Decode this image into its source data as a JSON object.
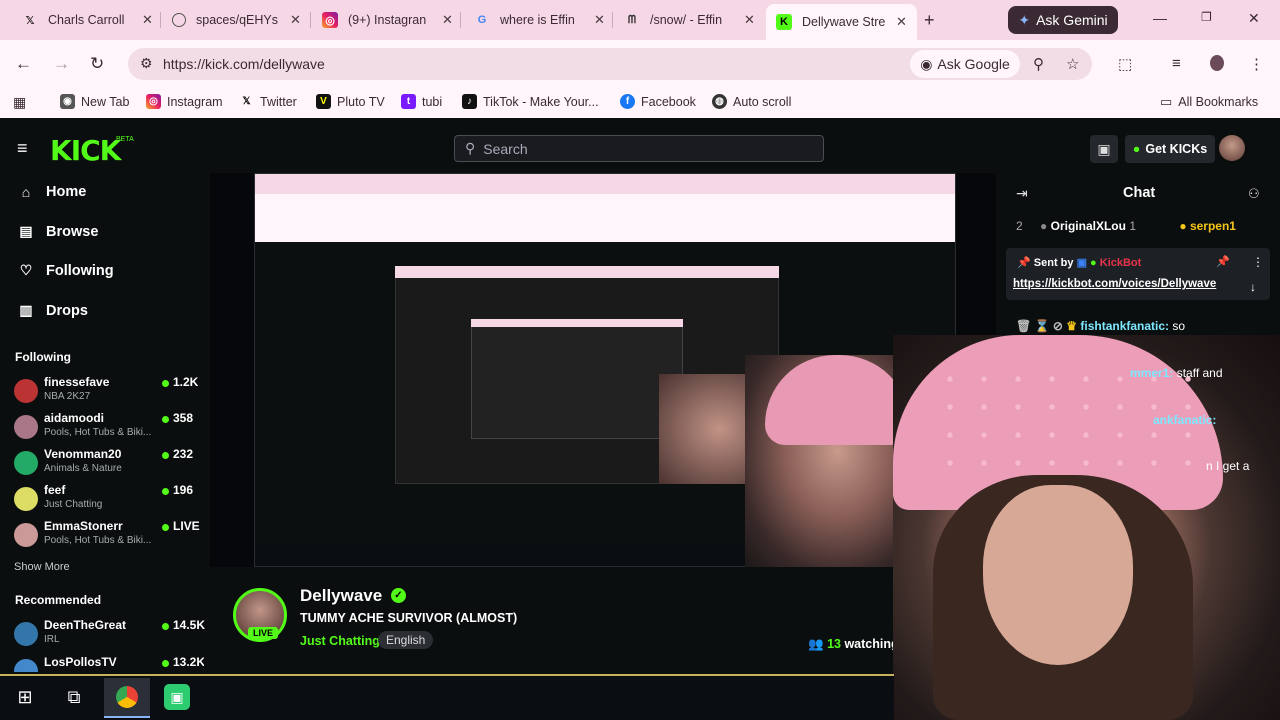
{
  "browser": {
    "tabs": [
      {
        "label": "Charls Carroll",
        "icon": "x-icon"
      },
      {
        "label": "spaces/qEHYs",
        "icon": "globe-icon"
      },
      {
        "label": "(9+) Instagran",
        "icon": "instagram-icon"
      },
      {
        "label": "where is Effin",
        "icon": "google-icon"
      },
      {
        "label": "/snow/ - Effin",
        "icon": "site-icon"
      },
      {
        "label": "Dellywave Stre",
        "icon": "kick-icon"
      }
    ],
    "ask_gemini": "Ask Gemini",
    "url": "https://kick.com/dellywave",
    "ask_google": "Ask Google",
    "bookmarks": [
      "New Tab",
      "Instagram",
      "Twitter",
      "Pluto TV",
      "tubi",
      "TikTok - Make Your...",
      "Facebook",
      "Auto scroll"
    ],
    "all_bookmarks": "All Bookmarks"
  },
  "kick": {
    "logo": "KICK",
    "beta": "BETA",
    "search_placeholder": "Search",
    "get_kicks": "Get KICKs",
    "nav": [
      {
        "label": "Home",
        "icon": "home-icon"
      },
      {
        "label": "Browse",
        "icon": "browse-icon"
      },
      {
        "label": "Following",
        "icon": "heart-icon"
      },
      {
        "label": "Drops",
        "icon": "drops-icon"
      }
    ],
    "following_heading": "Following",
    "following": [
      {
        "name": "finessefave",
        "category": "NBA 2K27",
        "count": "1.2K"
      },
      {
        "name": "aidamoodi",
        "category": "Pools, Hot Tubs & Biki...",
        "count": "358"
      },
      {
        "name": "Venomman20",
        "category": "Animals & Nature",
        "count": "232"
      },
      {
        "name": "feef",
        "category": "Just Chatting",
        "count": "196"
      },
      {
        "name": "EmmaStonerr",
        "category": "Pools, Hot Tubs & Biki...",
        "count": "LIVE"
      }
    ],
    "show_more": "Show More",
    "recommended_heading": "Recommended",
    "recommended": [
      {
        "name": "DeenTheGreat",
        "category": "IRL",
        "count": "14.5K"
      },
      {
        "name": "LosPollosTV",
        "category": "",
        "count": "13.2K"
      }
    ],
    "stream": {
      "name": "Dellywave",
      "title": "TUMMY ACHE SURVIVOR (ALMOST)",
      "category": "Just Chatting",
      "language": "English",
      "watching_count": "13",
      "watching_label": "watching",
      "live": "LIVE"
    },
    "chat": {
      "title": "Chat",
      "gift_rank": "2",
      "gift_user": "OriginalXLou",
      "gift_count": "1",
      "gift_user2": "serpen1",
      "pinned_sent_by": "Sent by",
      "pinned_bot": "KickBot",
      "pinned_link": "https://kickbot.com/voices/Dellywave",
      "lines": [
        {
          "user": "fishtankfanatic:",
          "msg": "so"
        },
        {
          "user": "mmer1:",
          "msg": "staff and"
        },
        {
          "user": "ankfanatic:",
          "msg": ""
        },
        {
          "user": "",
          "msg": "n I get a"
        },
        {
          "user": "",
          "msg": "a"
        }
      ]
    }
  },
  "colors": {
    "kick_green": "#53fc18",
    "tabbar_pink": "#f6d7e6",
    "page_bg": "#0b0e0f"
  }
}
